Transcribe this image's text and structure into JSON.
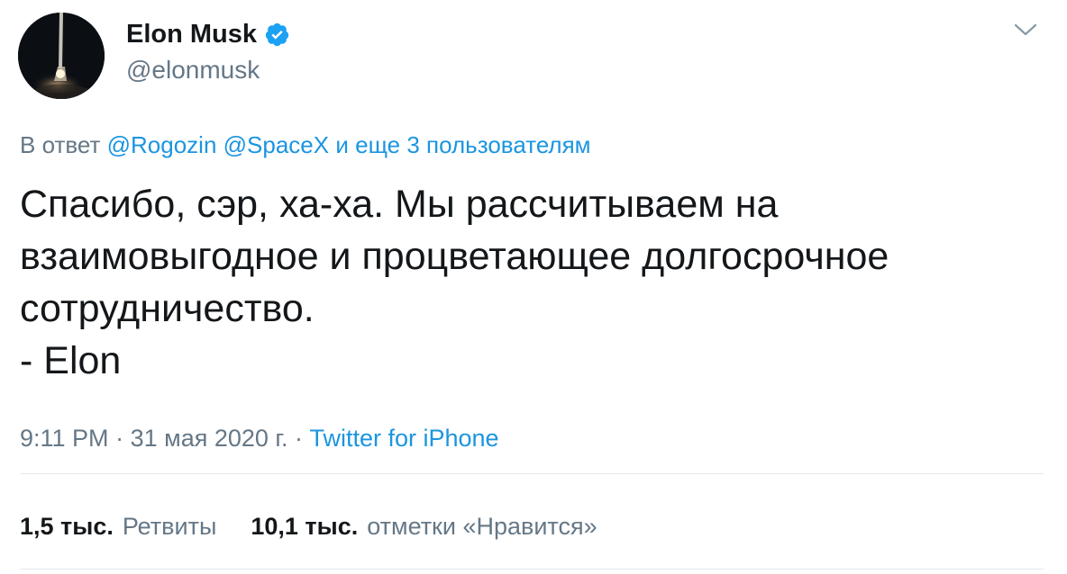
{
  "author": {
    "name": "Elon Musk",
    "handle": "@elonmusk"
  },
  "reply": {
    "prefix": "В ответ",
    "mention1": "@Rogozin",
    "mention2": "@SpaceX",
    "others": "и еще 3 пользователям"
  },
  "tweet": {
    "text": "Спасибо, сэр, ха-ха. Мы рассчитываем на\nвзаимовыгодное и процветающее долгосрочное\nсотрудничество.\n- Elon"
  },
  "meta": {
    "time": "9:11 PM",
    "separator": "·",
    "date": "31 мая 2020 г.",
    "source": "Twitter for iPhone"
  },
  "stats": {
    "retweets_count": "1,5 тыс.",
    "retweets_label": "Ретвиты",
    "likes_count": "10,1 тыс.",
    "likes_label": "отметки «Нравится»"
  },
  "colors": {
    "link": "#1b95e0",
    "secondary": "#657786",
    "verified": "#1da1f2"
  },
  "icons": {
    "verified": "verified-badge-icon",
    "caret": "chevron-down-icon"
  }
}
